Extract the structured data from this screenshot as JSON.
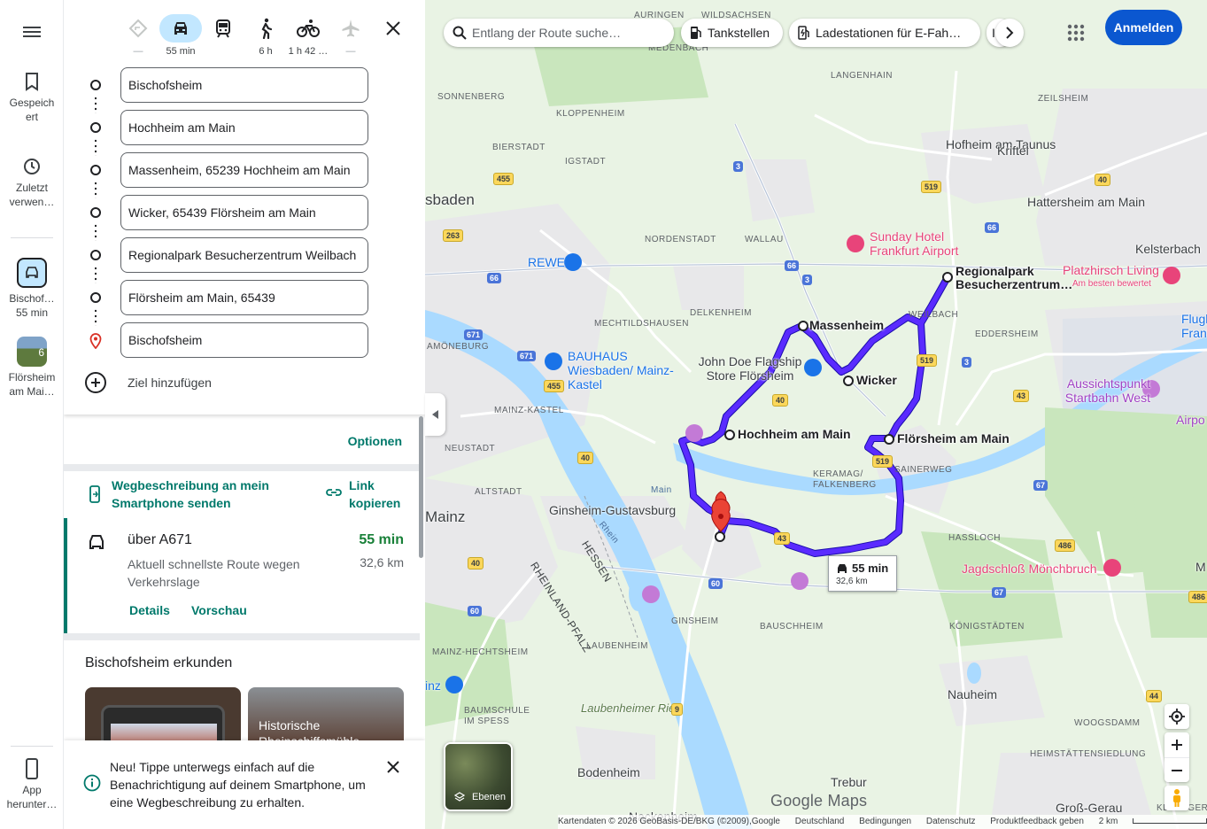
{
  "rail": {
    "saved_label": "Gespeich\nert",
    "recent_label": "Zuletzt verwen…",
    "trip1_label": "Bischof…",
    "trip1_time": "55 min",
    "trip2_label": "Flörsheim am Mai…",
    "trip2_badge": "6",
    "app_label": "App herunter…"
  },
  "modes": [
    {
      "name": "best",
      "label": "—"
    },
    {
      "name": "car",
      "label": "55 min"
    },
    {
      "name": "transit",
      "label": ""
    },
    {
      "name": "walk",
      "label": "6 h"
    },
    {
      "name": "bike",
      "label": "1 h 42 …"
    },
    {
      "name": "flight",
      "label": "—"
    }
  ],
  "waypoints": [
    "Bischofsheim",
    "Hochheim am Main",
    "Massenheim, 65239 Hochheim am Main",
    "Wicker, 65439 Flörsheim am Main",
    "Regionalpark Besucherzentrum Weilbach",
    "Flörsheim am Main, 65439",
    "Bischofsheim"
  ],
  "add_destination": "Ziel hinzufügen",
  "options_label": "Optionen",
  "send_to_phone": "Wegbeschreibung an mein Smartphone senden",
  "copy_link": "Link kopieren",
  "route": {
    "via": "über A671",
    "description": "Aktuell schnellste Route wegen Verkehrslage",
    "time": "55 min",
    "distance": "32,6 km",
    "details": "Details",
    "preview": "Vorschau"
  },
  "explore": {
    "title": "Bischofsheim erkunden",
    "card2_text": "Historische Rheinschiffsmühle"
  },
  "toast": {
    "message": "Neu! Tippe unterwegs einfach auf die Benachrichtigung auf deinem Smartphone, um eine Wegbeschreibung zu erhalten."
  },
  "map": {
    "search_placeholder": "Entlang der Route suche…",
    "chips": [
      "Tankstellen",
      "Ladestationen für E-Fah…",
      "I"
    ],
    "signin": "Anmelden",
    "layers_label": "Ebenen",
    "google": "Google Maps",
    "eta_time": "55 min",
    "eta_dist": "32,6 km",
    "footer": [
      "Kartendaten © 2026 GeoBasis-DE/BKG (©2009),Google",
      "Deutschland",
      "Bedingungen",
      "Datenschutz",
      "Produktfeedback geben",
      "2 km"
    ],
    "waypoint_labels": [
      "Massenheim",
      "Wicker",
      "Hochheim am Main",
      "Flörsheim am Main",
      "Regionalpark Besucherzentrum…"
    ],
    "towns": [
      "Hofheim am Taunus",
      "Kriftel",
      "Hattersheim am Main",
      "Kelsterbach",
      "sbaden",
      "Mainz",
      "Ginsheim-Gustavsburg",
      "Nauheim",
      "Bodenheim",
      "Trebur",
      "Groß-Gerau",
      "Laubenheimer Ried"
    ],
    "small_labels": [
      "AURINGEN",
      "WILDSACHSEN",
      "MEDENBACH",
      "LANGENHAIN",
      "SONNENBERG",
      "KLOPPENHEIM",
      "ZEILSHEIM",
      "BIERSTADT",
      "IGSTADT",
      "NORDENSTADT",
      "WALLAU",
      "DELKENHEIM",
      "MECHTILDSHAUSEN",
      "AMÖNEBURG",
      "MAINZ-KASTEL",
      "NEUSTADT",
      "ALTSTADT",
      "EDDERSHEIM",
      "WEILBACH",
      "KERAMAG/ FALKENBERG",
      "SAINERWEG",
      "HASSLOCH",
      "GINSHEIM",
      "BAUSCHHEIM",
      "KÖNIGSTÄDTEN",
      "MAINZ-HECHTSHEIM",
      "LAUBENHEIM",
      "BAUMSCHULE IM SPESS",
      "WOOGSDAMM",
      "HEIMSTÄTTENSIEDLUNG",
      "KLEIN-GER",
      "RHEINLAND-PFALZ",
      "HESSEN",
      "Main",
      "Rhein",
      "Nackenheim"
    ],
    "pois": [
      "REWE",
      "BAUHAUS Wiesbaden/ Mainz-Kastel",
      "John Doe Flagship Store Flörsheim",
      "Sunday Hotel Frankfurt Airport",
      "Platzhirsch Living",
      "Am besten bewertet",
      "Aussichtspunkt Startbahn West",
      "Jagdschloß Mönchbruch",
      "Flugh Frank",
      "Airpo",
      "M",
      "inz"
    ],
    "shields": [
      "455",
      "263",
      "3",
      "66",
      "66",
      "671",
      "671",
      "455",
      "40",
      "40",
      "519",
      "519",
      "3",
      "43",
      "43",
      "40",
      "486",
      "67",
      "60",
      "60",
      "9",
      "44",
      "40",
      "3",
      "66",
      "519",
      "40",
      "67",
      "486"
    ],
    "colors": {
      "route": "#3b17e6",
      "accent": "#00796b",
      "signin": "#0b57d0",
      "water": "#aadaff"
    }
  }
}
